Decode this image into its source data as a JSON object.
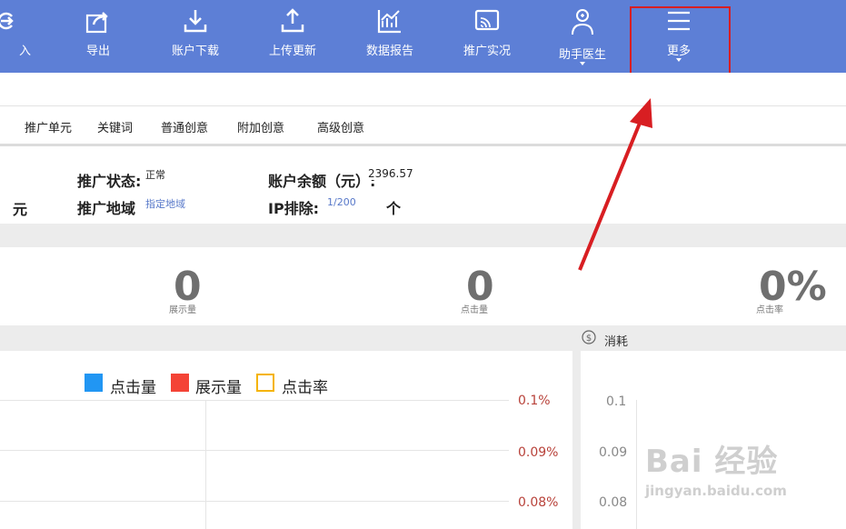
{
  "toolbar": {
    "items": [
      {
        "label": "入",
        "icon": "import-icon"
      },
      {
        "label": "导出",
        "icon": "export-icon"
      },
      {
        "label": "账户下载",
        "icon": "download-icon"
      },
      {
        "label": "上传更新",
        "icon": "upload-icon"
      },
      {
        "label": "数据报告",
        "icon": "chart-report-icon"
      },
      {
        "label": "推广实况",
        "icon": "live-cast-icon"
      },
      {
        "label": "助手医生",
        "icon": "doctor-icon"
      },
      {
        "label": "更多",
        "icon": "menu-icon"
      }
    ],
    "bg_color": "#5d7fd6"
  },
  "tabs": [
    "推广单元",
    "关键词",
    "普通创意",
    "附加创意",
    "高级创意"
  ],
  "info": {
    "unit_label": "元",
    "status_label": "推广状态:",
    "status_value": "正常",
    "region_label": "推广地域",
    "region_value": "指定地域",
    "balance_label": "账户余额（元）:",
    "balance_value": "2396.57",
    "ip_label": "IP排除:",
    "ip_value": "1/200",
    "ip_unit": "个"
  },
  "stats": [
    {
      "value": "0",
      "label": "展示量"
    },
    {
      "value": "0",
      "label": "点击量"
    },
    {
      "value": "0%",
      "label": "点击率"
    }
  ],
  "consume": {
    "label": "消耗",
    "icon": "dollar-icon"
  },
  "legend": [
    {
      "label": "点击量",
      "color": "#2196f3"
    },
    {
      "label": "展示量",
      "color": "#f44336"
    },
    {
      "label": "点击率",
      "color": "#f5b400"
    }
  ],
  "left_axis_ticks": [
    "0.1%",
    "0.09%",
    "0.08%"
  ],
  "right_axis_ticks": [
    "0.1",
    "0.09",
    "0.08"
  ],
  "watermark": {
    "main": "Bai  经验",
    "sub": "jingyan.baidu.com"
  },
  "annotation_color": "#d81e22"
}
